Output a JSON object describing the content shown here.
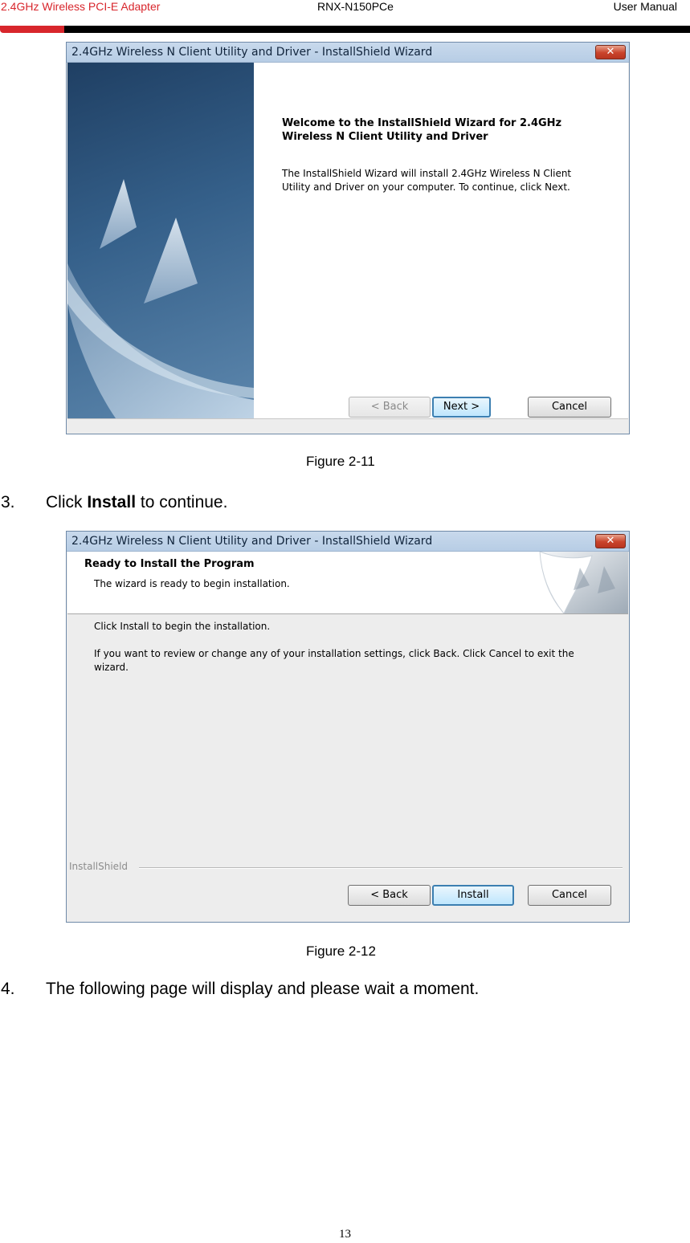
{
  "header": {
    "product": "2.4GHz Wireless PCI-E Adapter",
    "model": "RNX-N150PCe",
    "doc_type": "User Manual",
    "accent_color": "#d8262c"
  },
  "dialog1": {
    "title": "2.4GHz Wireless N Client Utility and Driver - InstallShield Wizard",
    "close_glyph": "✕",
    "heading": "Welcome to the InstallShield Wizard for 2.4GHz Wireless N Client Utility and Driver",
    "body": "The InstallShield Wizard will install 2.4GHz Wireless N Client Utility and Driver on your computer.  To continue, click Next.",
    "buttons": {
      "back": "< Back",
      "next": "Next >",
      "cancel": "Cancel"
    }
  },
  "figure1_caption": "Figure 2-11",
  "step3": {
    "number": "3.",
    "prefix": "Click ",
    "bold": "Install",
    "suffix": " to continue."
  },
  "dialog2": {
    "title": "2.4GHz Wireless N Client Utility and Driver - InstallShield Wizard",
    "close_glyph": "✕",
    "banner_title": "Ready to Install the Program",
    "banner_subtitle": "The wizard is ready to begin installation.",
    "line1": "Click Install to begin the installation.",
    "line2": "If you want to review or change any of your installation settings, click Back. Click Cancel to exit the wizard.",
    "brand": "InstallShield",
    "buttons": {
      "back": "< Back",
      "install": "Install",
      "cancel": "Cancel"
    }
  },
  "figure2_caption": "Figure 2-12",
  "step4": {
    "number": "4.",
    "text": "The following page will display and please wait a moment."
  },
  "page_number": "13"
}
